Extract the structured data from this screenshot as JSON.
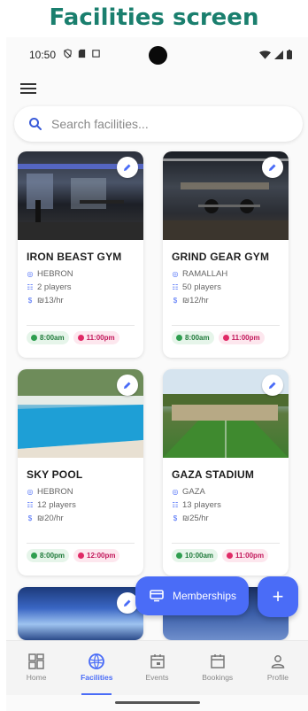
{
  "heading": "Facilities screen",
  "status": {
    "time": "10:50"
  },
  "search": {
    "placeholder": "Search facilities..."
  },
  "facilities": [
    {
      "name": "IRON BEAST GYM",
      "location": "HEBRON",
      "players": "2 players",
      "price": "₪13/hr",
      "open": "8:00am",
      "close": "11:00pm"
    },
    {
      "name": "GRIND GEAR GYM",
      "location": "RAMALLAH",
      "players": "50 players",
      "price": "₪12/hr",
      "open": "8:00am",
      "close": "11:00pm"
    },
    {
      "name": "SKY POOL",
      "location": "HEBRON",
      "players": "12 players",
      "price": "₪20/hr",
      "open": "8:00pm",
      "close": "12:00pm"
    },
    {
      "name": "GAZA STADIUM",
      "location": "GAZA",
      "players": "13 players",
      "price": "₪25/hr",
      "open": "10:00am",
      "close": "11:00pm"
    }
  ],
  "fab": {
    "memberships_label": "Memberships",
    "add_label": "+"
  },
  "nav": [
    {
      "label": "Home",
      "icon": "dashboard-icon"
    },
    {
      "label": "Facilities",
      "icon": "sports-ball-icon",
      "active": true
    },
    {
      "label": "Events",
      "icon": "calendar-event-icon"
    },
    {
      "label": "Bookings",
      "icon": "calendar-icon"
    },
    {
      "label": "Profile",
      "icon": "person-icon"
    }
  ],
  "colors": {
    "accent": "#4a6cf7",
    "heading": "#1a7f6e",
    "open_chip": "#2e9e4f",
    "close_chip": "#e02a66"
  }
}
